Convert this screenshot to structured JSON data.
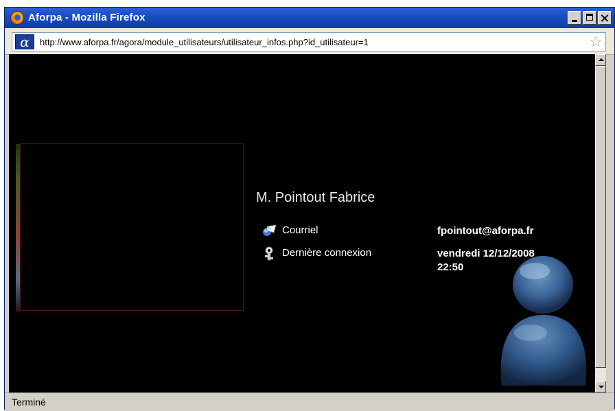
{
  "window": {
    "title": "Aforpa - Mozilla Firefox"
  },
  "addressbar": {
    "site_icon": "α",
    "url": "http://www.aforpa.fr/agora/module_utilisateurs/utilisateur_infos.php?id_utilisateur=1",
    "bookmark_icon": "star-icon"
  },
  "profile": {
    "name": "M. Pointout Fabrice",
    "fields": [
      {
        "icon": "email-icon",
        "label": "Courriel",
        "value": "fpointout@aforpa.fr"
      },
      {
        "icon": "key-icon",
        "label": "Dernière connexion",
        "value_line1": "vendredi 12/12/2008",
        "value_line2": "22:50"
      }
    ]
  },
  "statusbar": {
    "text": "Terminé"
  },
  "colors": {
    "titlebar": "#0b3da8",
    "content_bg": "#000000",
    "chrome": "#d4d0c8"
  }
}
